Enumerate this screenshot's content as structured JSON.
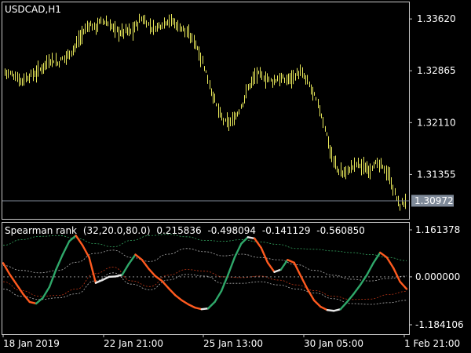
{
  "symbol_title": "USDCAD,H1",
  "indicator": {
    "name": "Spearman rank",
    "params": "(32,20.0,80.0)",
    "values": [
      "0.215836",
      "-0.498094",
      "-0.141129",
      "-0.560850"
    ]
  },
  "colors": {
    "background": "#000000",
    "frame": "#c8c8c8",
    "bars": "#e8e85a",
    "bid_line": "#7f8a99",
    "bid_box": "#7f8a99",
    "spearman_up": "#2fa86a",
    "spearman_down": "#ff5a1f",
    "spearman_neutral": "#e8e8e8",
    "band_up": "#3cbf6f",
    "band_down": "#e0401a",
    "band_mid": "#cfcfcf"
  },
  "chart_data": [
    {
      "type": "bar",
      "symbol": "USDCAD",
      "timeframe": "H1",
      "ylim": [
        1.3072,
        1.3385
      ],
      "y_ticks": [
        "1.33620",
        "1.32865",
        "1.32110",
        "1.31355"
      ],
      "y_tick_values": [
        1.3362,
        1.32865,
        1.3211,
        1.31355
      ],
      "current_price": "1.30972",
      "current_price_value": 1.30972,
      "close_path": [
        1.3285,
        1.3282,
        1.3279,
        1.3272,
        1.3276,
        1.328,
        1.3284,
        1.3291,
        1.3299,
        1.3304,
        1.3297,
        1.3304,
        1.331,
        1.3318,
        1.3332,
        1.3344,
        1.3355,
        1.3349,
        1.3357,
        1.3359,
        1.3352,
        1.3346,
        1.3342,
        1.3345,
        1.3343,
        1.3354,
        1.3363,
        1.3356,
        1.3348,
        1.3351,
        1.3356,
        1.3361,
        1.3357,
        1.3351,
        1.3347,
        1.3336,
        1.333,
        1.331,
        1.3289,
        1.3262,
        1.3239,
        1.3219,
        1.321,
        1.3212,
        1.3222,
        1.3238,
        1.3259,
        1.3274,
        1.3282,
        1.3277,
        1.3274,
        1.3271,
        1.3276,
        1.3273,
        1.3275,
        1.328,
        1.3284,
        1.3275,
        1.3262,
        1.3245,
        1.3224,
        1.3196,
        1.3162,
        1.3145,
        1.3136,
        1.3141,
        1.3147,
        1.3152,
        1.3146,
        1.3142,
        1.3151,
        1.3149,
        1.3144,
        1.3132,
        1.3107,
        1.309,
        1.3097
      ]
    },
    {
      "type": "line",
      "indicator": "Spearman rank",
      "ylim": [
        -1.184106,
        1.161378
      ],
      "y_ticks": [
        "1.161378",
        "0.000000",
        "-1.184106"
      ],
      "y_tick_values": [
        1.161378,
        0,
        -1.184106
      ],
      "series": [
        {
          "name": "Spearman rank",
          "values": [
            0.34,
            0.06,
            -0.18,
            -0.42,
            -0.62,
            -0.66,
            -0.52,
            -0.25,
            0.18,
            0.55,
            0.88,
            1.02,
            0.78,
            0.48,
            -0.15,
            -0.08,
            0.0,
            0.01,
            0.05,
            0.32,
            0.55,
            0.42,
            0.2,
            0.02,
            -0.1,
            -0.28,
            -0.45,
            -0.58,
            -0.68,
            -0.76,
            -0.8,
            -0.78,
            -0.62,
            -0.35,
            0.05,
            0.48,
            0.82,
            0.98,
            0.95,
            0.72,
            0.35,
            0.12,
            0.18,
            0.42,
            0.35,
            0.02,
            -0.3,
            -0.58,
            -0.74,
            -0.82,
            -0.84,
            -0.8,
            -0.62,
            -0.42,
            -0.2,
            0.05,
            0.35,
            0.6,
            0.48,
            0.22,
            -0.12,
            -0.3
          ]
        },
        {
          "values": [
            0.78,
            0.92,
            1.0,
            1.02,
            0.95,
            0.82,
            0.74,
            0.9,
            1.02,
            1.05,
            0.99,
            0.9,
            0.88,
            0.92,
            0.86,
            0.8,
            0.7,
            0.68,
            0.64,
            0.6,
            0.55,
            0.48,
            0.4
          ]
        },
        {
          "values": [
            -0.12,
            -0.34,
            -0.48,
            -0.46,
            -0.3,
            0.08,
            0.24,
            -0.1,
            -0.24,
            0.04,
            0.18,
            0.14,
            0.0,
            -0.02,
            0.02,
            -0.08,
            -0.2,
            -0.34,
            -0.48,
            -0.56,
            -0.55,
            -0.44,
            -0.36
          ]
        },
        {
          "values": [
            0.28,
            0.16,
            0.1,
            0.16,
            0.36,
            0.58,
            0.66,
            0.48,
            0.38,
            0.56,
            0.7,
            0.62,
            0.52,
            0.56,
            0.48,
            0.42,
            0.3,
            0.16,
            0.04,
            -0.06,
            -0.1,
            -0.04,
            0.02
          ]
        },
        {
          "values": [
            -0.3,
            -0.48,
            -0.56,
            -0.52,
            -0.42,
            -0.1,
            0.1,
            -0.18,
            -0.32,
            -0.08,
            0.06,
            0.02,
            -0.16,
            -0.16,
            -0.12,
            -0.2,
            -0.3,
            -0.4,
            -0.54,
            -0.66,
            -0.68,
            -0.64,
            -0.58
          ]
        }
      ]
    }
  ],
  "x_axis": {
    "labels": [
      "18 Jan 2019",
      "22 Jan 21:00",
      "25 Jan 13:00",
      "30 Jan 05:00",
      "1 Feb 21:00"
    ]
  }
}
